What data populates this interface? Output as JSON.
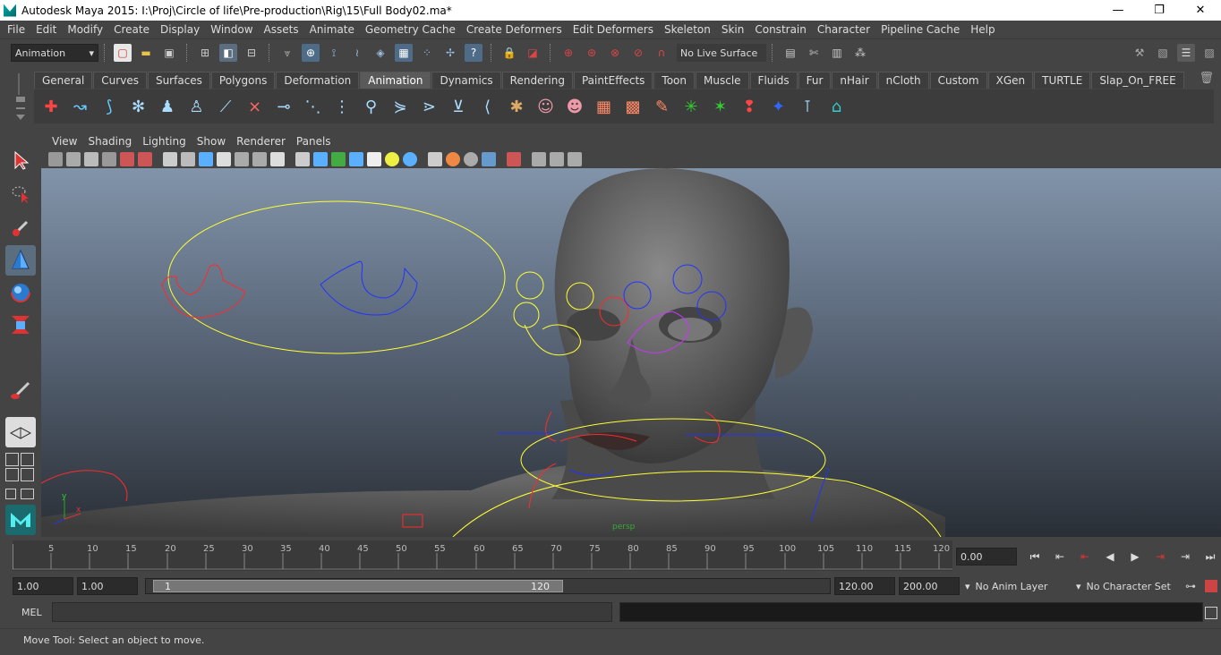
{
  "window": {
    "title": "Autodesk Maya 2015: I:\\Proj\\Circle of life\\Pre-production\\Rig\\15\\Full Body02.ma*",
    "minimize": "—",
    "maximize": "❐",
    "close": "✕"
  },
  "menus": [
    "File",
    "Edit",
    "Modify",
    "Create",
    "Display",
    "Window",
    "Assets",
    "Animate",
    "Geometry Cache",
    "Create Deformers",
    "Edit Deformers",
    "Skeleton",
    "Skin",
    "Constrain",
    "Character",
    "Pipeline Cache",
    "Help"
  ],
  "status_line": {
    "menu_set": "Animation",
    "live_surface": "No Live Surface"
  },
  "shelf": {
    "tabs": [
      "General",
      "Curves",
      "Surfaces",
      "Polygons",
      "Deformation",
      "Animation",
      "Dynamics",
      "Rendering",
      "PaintEffects",
      "Toon",
      "Muscle",
      "Fluids",
      "Fur",
      "nHair",
      "nCloth",
      "Custom",
      "XGen",
      "TURTLE",
      "Slap_On_FREE"
    ],
    "active_tab": "Animation"
  },
  "panel_menus": [
    "View",
    "Shading",
    "Lighting",
    "Show",
    "Renderer",
    "Panels"
  ],
  "viewport": {
    "camera_label": "persp",
    "axis_y": "y",
    "axis_x": "x"
  },
  "time_slider": {
    "ticks": [
      "5",
      "10",
      "15",
      "20",
      "25",
      "30",
      "35",
      "40",
      "45",
      "50",
      "55",
      "60",
      "65",
      "70",
      "75",
      "80",
      "85",
      "90",
      "95",
      "100",
      "105",
      "110",
      "115",
      "120"
    ],
    "current_time": "0.00"
  },
  "range_slider": {
    "animation_start": "1.00",
    "playback_start": "1.00",
    "range_start_label": "1",
    "range_end_label": "120",
    "playback_end": "120.00",
    "animation_end": "200.00",
    "anim_layer": "No Anim Layer",
    "character_set": "No Character Set"
  },
  "command_line": {
    "label": "MEL"
  },
  "help_line": {
    "text": "Move Tool: Select an object to move."
  },
  "colors": {
    "ui_bg": "#444444",
    "viewport_top": "#8294aa",
    "viewport_bottom": "#2a2f36",
    "ctrl_yellow": "#ffff33",
    "ctrl_red": "#ff2a2a",
    "ctrl_blue": "#2233ff",
    "ctrl_magenta": "#cc33ff"
  }
}
